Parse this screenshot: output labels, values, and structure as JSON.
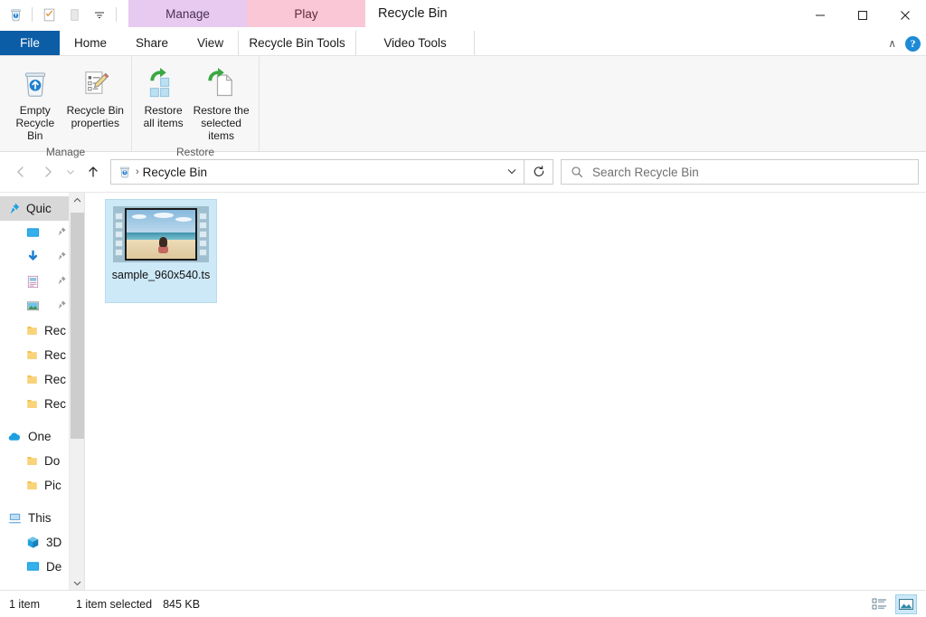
{
  "window": {
    "title": "Recycle Bin",
    "minimize_label": "─",
    "maximize_label": "☐",
    "close_label": "✕"
  },
  "quick_access_toolbar": {
    "items": [
      {
        "name": "recycle-bin-icon",
        "tooltip": "Recycle Bin"
      },
      {
        "name": "properties-icon",
        "tooltip": "Properties"
      },
      {
        "name": "new-folder-icon",
        "tooltip": "New folder"
      }
    ],
    "customize_label": "▾"
  },
  "contextual_tabs": [
    {
      "header": "Manage",
      "sub": "Recycle Bin Tools",
      "color": "#e8c9ef",
      "active": true
    },
    {
      "header": "Play",
      "sub": "Video Tools",
      "color": "#f9c7d6",
      "active": false
    }
  ],
  "ribbon_tabs": {
    "file": "File",
    "items": [
      "Home",
      "Share",
      "View"
    ]
  },
  "ribbon_right": {
    "collapse_label": "∧",
    "help_label": "?"
  },
  "ribbon": {
    "groups": [
      {
        "label": "Manage",
        "buttons": [
          {
            "name": "empty-recycle-bin-button",
            "line1": "Empty",
            "line2": "Recycle Bin",
            "icon": "recycle-bin-icon"
          },
          {
            "name": "recycle-bin-properties-button",
            "line1": "Recycle Bin",
            "line2": "properties",
            "icon": "properties-icon"
          }
        ]
      },
      {
        "label": "Restore",
        "buttons": [
          {
            "name": "restore-all-items-button",
            "line1": "Restore",
            "line2": "all items",
            "icon": "restore-all-icon"
          },
          {
            "name": "restore-selected-items-button",
            "line1": "Restore the",
            "line2": "selected items",
            "icon": "restore-selected-icon"
          }
        ]
      }
    ]
  },
  "address_bar": {
    "back_label": "←",
    "forward_label": "→",
    "recent_label": "⌄",
    "up_label": "↑",
    "breadcrumb_icon": "recycle-bin-icon",
    "breadcrumb_separator": "›",
    "path": "Recycle Bin",
    "dropdown_label": "⌄",
    "refresh_label": "↻"
  },
  "search": {
    "placeholder": "Search Recycle Bin",
    "icon": "search-icon"
  },
  "navigation_pane": {
    "scroll_up_label": "∧",
    "scroll_down_label": "∨",
    "items": [
      {
        "label": "Quic",
        "icon": "pin-star-icon",
        "selected": true,
        "indent": 0,
        "pinned": false
      },
      {
        "label": "",
        "icon": "desktop-icon",
        "selected": false,
        "indent": 1,
        "pinned": true
      },
      {
        "label": "",
        "icon": "downloads-icon",
        "selected": false,
        "indent": 1,
        "pinned": true
      },
      {
        "label": "",
        "icon": "documents-icon",
        "selected": false,
        "indent": 1,
        "pinned": true
      },
      {
        "label": "",
        "icon": "pictures-icon",
        "selected": false,
        "indent": 1,
        "pinned": true
      },
      {
        "label": "Rec",
        "icon": "folder-icon",
        "selected": false,
        "indent": 1,
        "pinned": false
      },
      {
        "label": "Rec",
        "icon": "folder-icon",
        "selected": false,
        "indent": 1,
        "pinned": false
      },
      {
        "label": "Rec",
        "icon": "folder-icon",
        "selected": false,
        "indent": 1,
        "pinned": false
      },
      {
        "label": "Rec",
        "icon": "folder-icon",
        "selected": false,
        "indent": 1,
        "pinned": false
      },
      {
        "label": "One",
        "icon": "onedrive-icon",
        "selected": false,
        "indent": 0,
        "pinned": false,
        "gap_before": true
      },
      {
        "label": "Do",
        "icon": "folder-icon",
        "selected": false,
        "indent": 1,
        "pinned": false
      },
      {
        "label": "Pic",
        "icon": "folder-icon",
        "selected": false,
        "indent": 1,
        "pinned": false
      },
      {
        "label": "This",
        "icon": "this-pc-icon",
        "selected": false,
        "indent": 0,
        "pinned": false,
        "gap_before": true
      },
      {
        "label": "3D",
        "icon": "3d-objects-icon",
        "selected": false,
        "indent": 1,
        "pinned": false
      },
      {
        "label": "De",
        "icon": "desktop-icon",
        "selected": false,
        "indent": 1,
        "pinned": false
      }
    ]
  },
  "content": {
    "files": [
      {
        "name": "sample_960x540.ts",
        "icon": "video-filmstrip-thumbnail",
        "selected": true
      }
    ]
  },
  "status_bar": {
    "item_count": "1 item",
    "selection": "1 item selected",
    "size": "845 KB",
    "views": [
      {
        "name": "details-view-button",
        "active": false
      },
      {
        "name": "large-icons-view-button",
        "active": true
      }
    ]
  },
  "colors": {
    "file_tab": "#0b5da6",
    "selection": "#cde8f7",
    "manage_tab": "#e8c9ef",
    "play_tab": "#f9c7d6",
    "help_blue": "#1e8ad6"
  }
}
